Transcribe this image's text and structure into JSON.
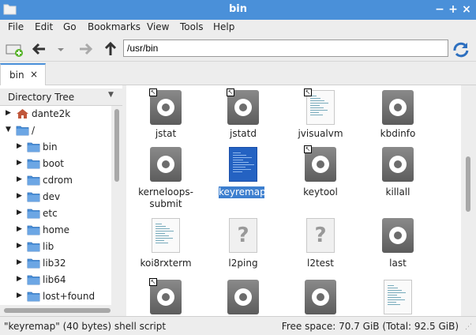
{
  "window": {
    "title": "bin",
    "controls": [
      "−",
      "+",
      "×"
    ]
  },
  "menubar": {
    "items": [
      "File",
      "Edit",
      "Go",
      "Bookmarks",
      "View",
      "Tools",
      "Help"
    ]
  },
  "toolbar": {
    "path_value": "/usr/bin"
  },
  "tabs": [
    {
      "label": "bin",
      "close": "×"
    }
  ],
  "sidebar": {
    "header": "Directory Tree",
    "tree": [
      {
        "label": "dante2k",
        "level": 0,
        "expanded": false,
        "icon": "home-folder-icon"
      },
      {
        "label": "/",
        "level": 0,
        "expanded": true,
        "icon": "folder-icon"
      },
      {
        "label": "bin",
        "level": 1,
        "expanded": false,
        "icon": "folder-icon"
      },
      {
        "label": "boot",
        "level": 1,
        "expanded": false,
        "icon": "folder-icon"
      },
      {
        "label": "cdrom",
        "level": 1,
        "expanded": false,
        "icon": "folder-icon"
      },
      {
        "label": "dev",
        "level": 1,
        "expanded": false,
        "icon": "folder-icon"
      },
      {
        "label": "etc",
        "level": 1,
        "expanded": false,
        "icon": "folder-icon"
      },
      {
        "label": "home",
        "level": 1,
        "expanded": false,
        "icon": "folder-icon"
      },
      {
        "label": "lib",
        "level": 1,
        "expanded": false,
        "icon": "folder-icon"
      },
      {
        "label": "lib32",
        "level": 1,
        "expanded": false,
        "icon": "folder-icon"
      },
      {
        "label": "lib64",
        "level": 1,
        "expanded": false,
        "icon": "folder-icon"
      },
      {
        "label": "lost+found",
        "level": 1,
        "expanded": false,
        "icon": "folder-icon"
      }
    ]
  },
  "files": [
    {
      "name": "jstat",
      "icon": "executable-icon",
      "symlink": true,
      "selected": false
    },
    {
      "name": "jstatd",
      "icon": "executable-icon",
      "symlink": true,
      "selected": false
    },
    {
      "name": "jvisualvm",
      "icon": "script-icon",
      "symlink": true,
      "selected": false
    },
    {
      "name": "kbdinfo",
      "icon": "executable-icon",
      "symlink": false,
      "selected": false
    },
    {
      "name": "kerneloops-submit",
      "icon": "executable-icon",
      "symlink": false,
      "selected": false
    },
    {
      "name": "keyremap",
      "icon": "script-icon",
      "symlink": false,
      "selected": true
    },
    {
      "name": "keytool",
      "icon": "executable-icon",
      "symlink": true,
      "selected": false
    },
    {
      "name": "killall",
      "icon": "executable-icon",
      "symlink": false,
      "selected": false
    },
    {
      "name": "koi8rxterm",
      "icon": "script-icon",
      "symlink": false,
      "selected": false
    },
    {
      "name": "l2ping",
      "icon": "unknown-file-icon",
      "symlink": false,
      "selected": false
    },
    {
      "name": "l2test",
      "icon": "unknown-file-icon",
      "symlink": false,
      "selected": false
    },
    {
      "name": "last",
      "icon": "executable-icon",
      "symlink": false,
      "selected": false
    },
    {
      "name": "",
      "icon": "executable-icon",
      "symlink": true,
      "selected": false
    },
    {
      "name": "",
      "icon": "executable-icon",
      "symlink": false,
      "selected": false
    },
    {
      "name": "",
      "icon": "executable-icon",
      "symlink": false,
      "selected": false
    },
    {
      "name": "",
      "icon": "script-icon",
      "symlink": false,
      "selected": false
    }
  ],
  "status": {
    "left": "\"keyremap\" (40 bytes) shell script",
    "right": "Free space: 70.7 GiB (Total: 92.5 GiB)"
  },
  "colors": {
    "accent": "#4a90d9",
    "selection": "#3d7fcf",
    "folder": "#4a90d9"
  }
}
